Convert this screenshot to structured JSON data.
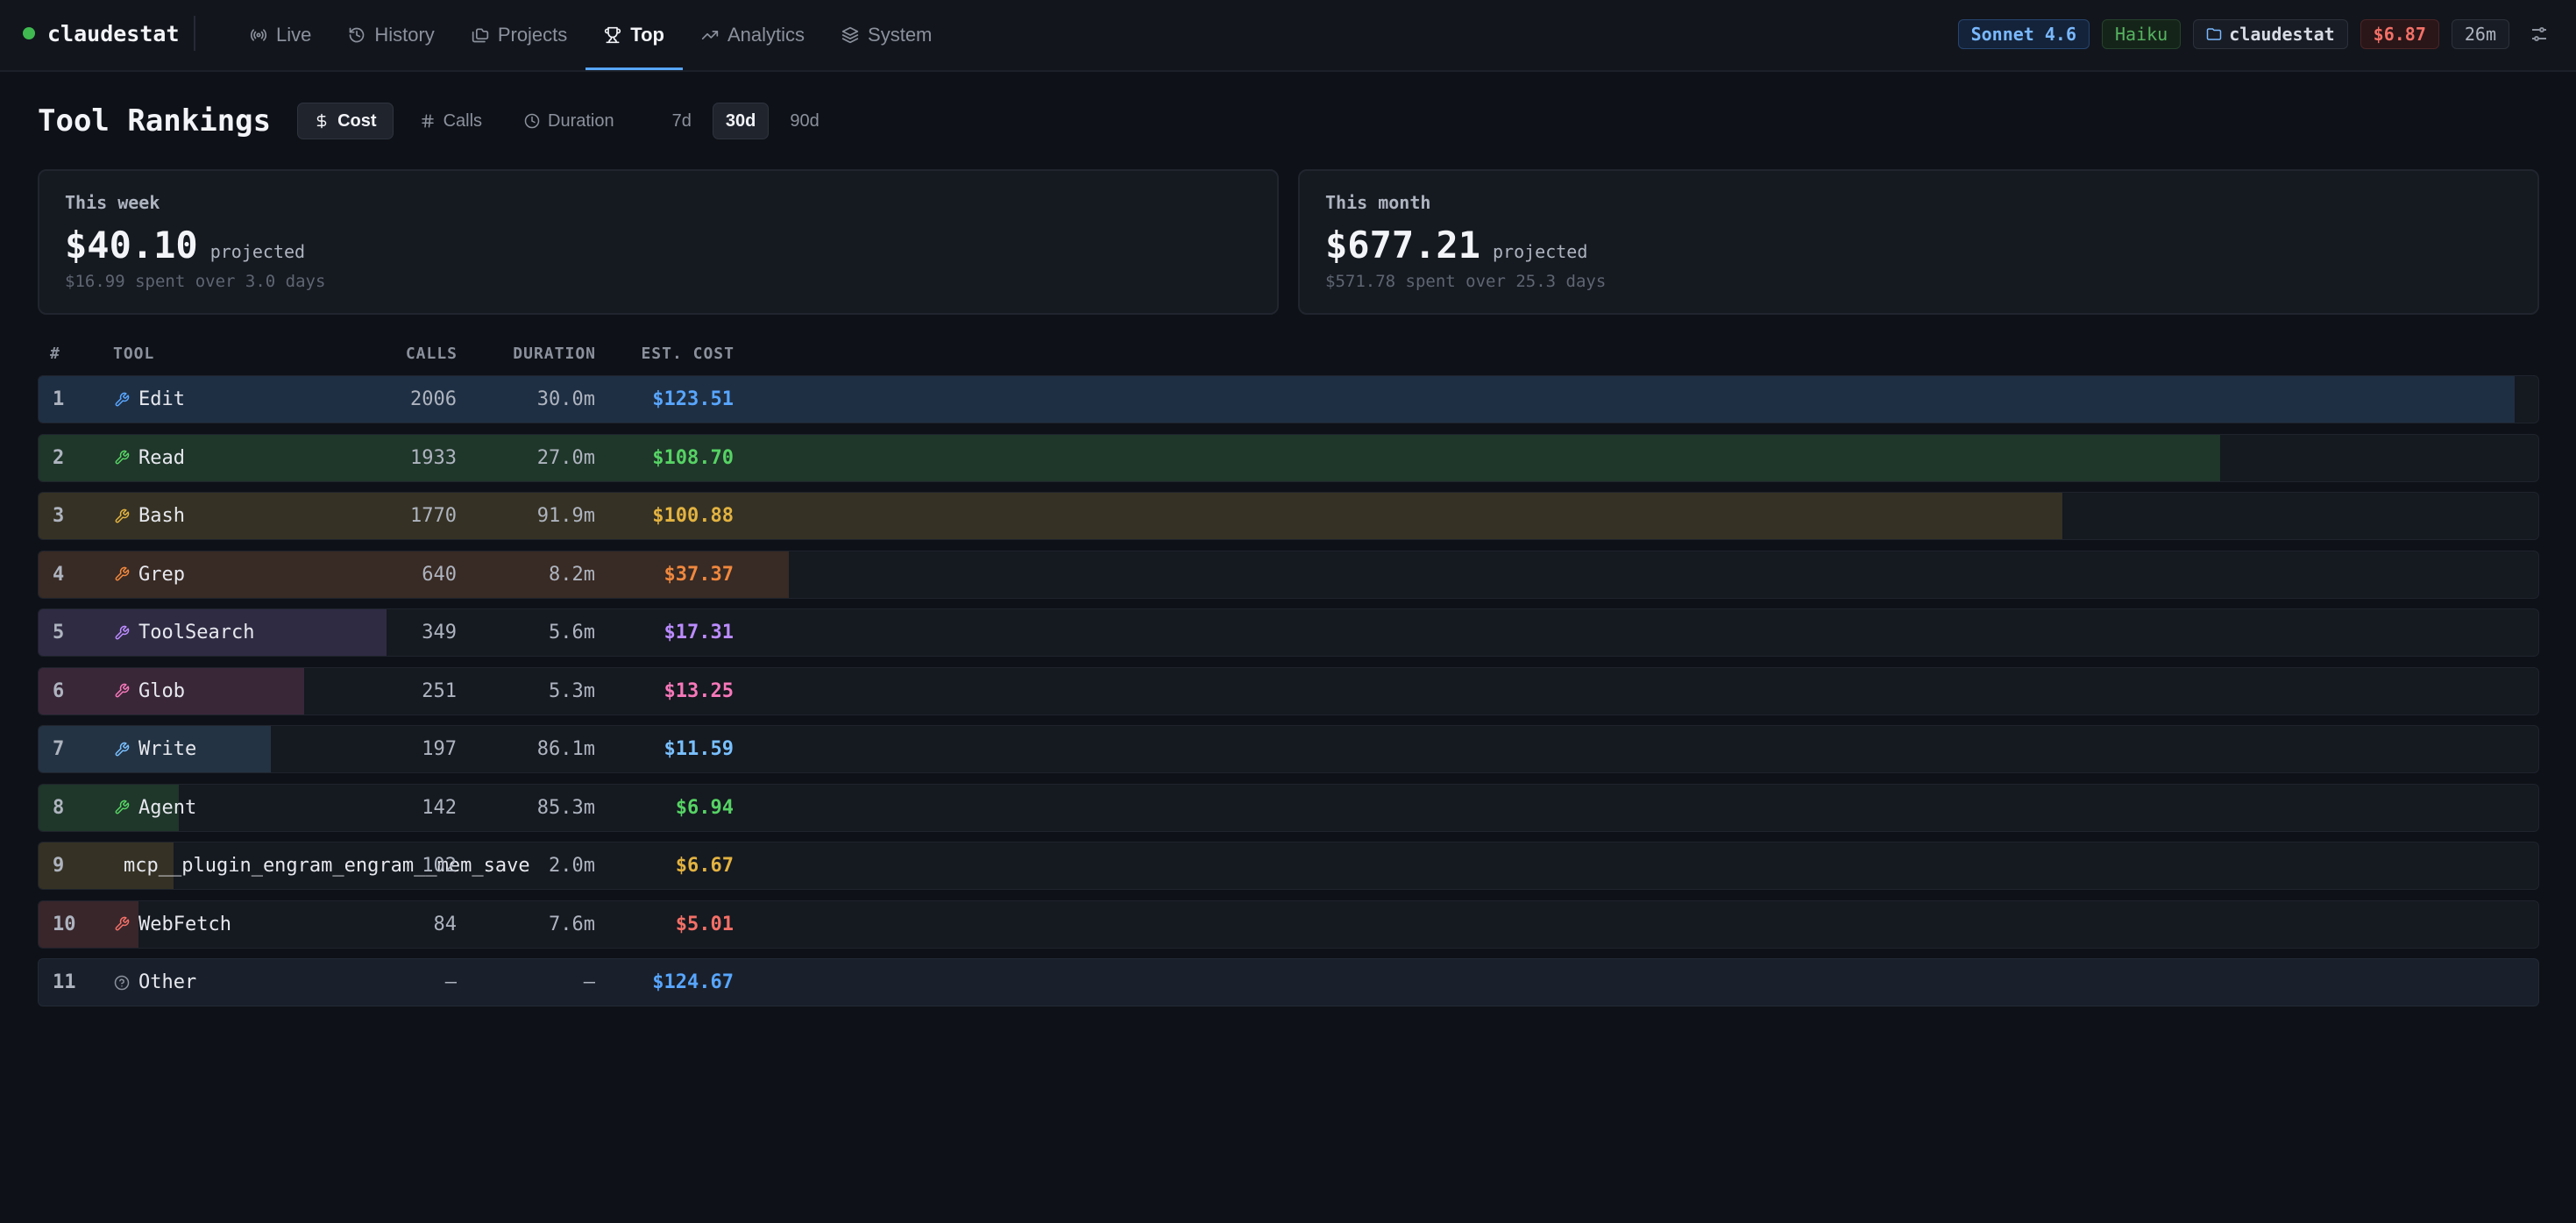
{
  "app": {
    "name": "claudestat"
  },
  "nav": {
    "items": [
      {
        "label": "Live",
        "icon": "radio-icon"
      },
      {
        "label": "History",
        "icon": "history-icon"
      },
      {
        "label": "Projects",
        "icon": "folders-icon"
      },
      {
        "label": "Top",
        "icon": "trophy-icon",
        "active": true
      },
      {
        "label": "Analytics",
        "icon": "trending-up-icon"
      },
      {
        "label": "System",
        "icon": "layers-icon"
      }
    ]
  },
  "status": {
    "model_primary": "Sonnet 4.6",
    "model_secondary": "Haiku",
    "project": "claudestat",
    "cost": "$6.87",
    "session_time": "26m"
  },
  "page": {
    "title": "Tool Rankings",
    "metrics": [
      {
        "label": "Cost",
        "icon": "dollar-icon",
        "active": true
      },
      {
        "label": "Calls",
        "icon": "hash-icon",
        "active": false
      },
      {
        "label": "Duration",
        "icon": "clock-icon",
        "active": false
      }
    ],
    "ranges": [
      {
        "label": "7d",
        "active": false
      },
      {
        "label": "30d",
        "active": true
      },
      {
        "label": "90d",
        "active": false
      }
    ]
  },
  "projections": {
    "week": {
      "label": "This week",
      "value": "$40.10",
      "suffix": "projected",
      "detail": "$16.99 spent over 3.0 days"
    },
    "month": {
      "label": "This month",
      "value": "$677.21",
      "suffix": "projected",
      "detail": "$571.78 spent over 25.3 days"
    }
  },
  "table": {
    "headers": {
      "rank": "#",
      "tool": "TOOL",
      "calls": "CALLS",
      "duration": "DURATION",
      "cost": "EST. COST"
    },
    "rows": [
      {
        "rank": "1",
        "tool": "Edit",
        "calls": "2006",
        "duration": "30.0m",
        "cost": "$123.51",
        "share": 0.99,
        "color": "#58a6ff",
        "icon": "wrench-icon"
      },
      {
        "rank": "2",
        "tool": "Read",
        "calls": "1933",
        "duration": "27.0m",
        "cost": "$108.70",
        "share": 0.872,
        "color": "#56d364",
        "icon": "wrench-icon"
      },
      {
        "rank": "3",
        "tool": "Bash",
        "calls": "1770",
        "duration": "91.9m",
        "cost": "$100.88",
        "share": 0.809,
        "color": "#e3b341",
        "icon": "wrench-icon"
      },
      {
        "rank": "4",
        "tool": "Grep",
        "calls": "640",
        "duration": "8.2m",
        "cost": "$37.37",
        "share": 0.3,
        "color": "#f0883e",
        "icon": "wrench-icon"
      },
      {
        "rank": "5",
        "tool": "ToolSearch",
        "calls": "349",
        "duration": "5.6m",
        "cost": "$17.31",
        "share": 0.139,
        "color": "#bc8cff",
        "icon": "wrench-icon"
      },
      {
        "rank": "6",
        "tool": "Glob",
        "calls": "251",
        "duration": "5.3m",
        "cost": "$13.25",
        "share": 0.106,
        "color": "#f778ba",
        "icon": "wrench-icon"
      },
      {
        "rank": "7",
        "tool": "Write",
        "calls": "197",
        "duration": "86.1m",
        "cost": "$11.59",
        "share": 0.093,
        "color": "#79c0ff",
        "icon": "wrench-icon"
      },
      {
        "rank": "8",
        "tool": "Agent",
        "calls": "142",
        "duration": "85.3m",
        "cost": "$6.94",
        "share": 0.056,
        "color": "#56d364",
        "icon": "wrench-icon"
      },
      {
        "rank": "9",
        "tool": "mcp__plugin_engram_engram__mem_save",
        "calls": "102",
        "duration": "2.0m",
        "cost": "$6.67",
        "share": 0.054,
        "color": "#e3b341",
        "icon": ""
      },
      {
        "rank": "10",
        "tool": "WebFetch",
        "calls": "84",
        "duration": "7.6m",
        "cost": "$5.01",
        "share": 0.04,
        "color": "#f47067",
        "icon": "wrench-icon"
      },
      {
        "rank": "11",
        "tool": "Other",
        "calls": "—",
        "duration": "—",
        "cost": "$124.67",
        "share": 1.0,
        "color": "#58a6ff",
        "icon": "help-circle-icon"
      }
    ]
  }
}
